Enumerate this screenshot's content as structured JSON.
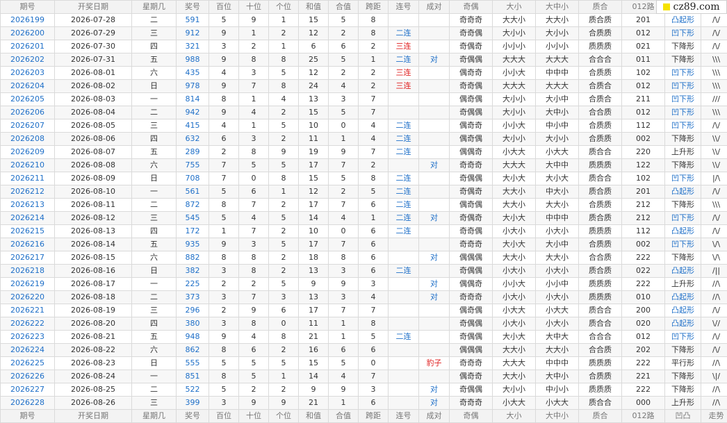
{
  "header": [
    "期号",
    "开奖日期",
    "星期几",
    "奖号",
    "百位",
    "十位",
    "个位",
    "和值",
    "合值",
    "跨距",
    "连号",
    "成对",
    "奇偶",
    "大小",
    "大中小",
    "质合",
    "012路",
    "凹凸",
    "走势"
  ],
  "logo": "cz89.com",
  "rows": [
    [
      "2026199",
      "2026-07-28",
      "二",
      "591",
      "5",
      "9",
      "1",
      "15",
      "5",
      "8",
      "",
      "",
      "奇奇奇",
      "大大小",
      "大大小",
      "质合质",
      "201",
      "凸起形",
      "/\\/"
    ],
    [
      "2026200",
      "2026-07-29",
      "三",
      "912",
      "9",
      "1",
      "2",
      "12",
      "2",
      "8",
      "二连",
      "",
      "奇奇偶",
      "大小小",
      "大小小",
      "合质质",
      "012",
      "凹下形",
      "/\\/"
    ],
    [
      "2026201",
      "2026-07-30",
      "四",
      "321",
      "3",
      "2",
      "1",
      "6",
      "6",
      "2",
      "三连",
      "",
      "奇偶奇",
      "小小小",
      "小小小",
      "质质质",
      "021",
      "下降形",
      "/\\/"
    ],
    [
      "2026202",
      "2026-07-31",
      "五",
      "988",
      "9",
      "8",
      "8",
      "25",
      "5",
      "1",
      "二连",
      "对",
      "奇偶偶",
      "大大大",
      "大大大",
      "合合合",
      "011",
      "下降形",
      "\\\\\\"
    ],
    [
      "2026203",
      "2026-08-01",
      "六",
      "435",
      "4",
      "3",
      "5",
      "12",
      "2",
      "2",
      "三连",
      "",
      "偶奇奇",
      "小小大",
      "中中中",
      "合质质",
      "102",
      "凹下形",
      "\\\\\\"
    ],
    [
      "2026204",
      "2026-08-02",
      "日",
      "978",
      "9",
      "7",
      "8",
      "24",
      "4",
      "2",
      "三连",
      "",
      "奇奇偶",
      "大大大",
      "大大大",
      "合质合",
      "012",
      "凹下形",
      "\\\\\\"
    ],
    [
      "2026205",
      "2026-08-03",
      "一",
      "814",
      "8",
      "1",
      "4",
      "13",
      "3",
      "7",
      "",
      "",
      "偶奇偶",
      "大小小",
      "大小中",
      "合质合",
      "211",
      "凹下形",
      "///"
    ],
    [
      "2026206",
      "2026-08-04",
      "二",
      "942",
      "9",
      "4",
      "2",
      "15",
      "5",
      "7",
      "",
      "",
      "奇偶偶",
      "大小小",
      "大中小",
      "合合质",
      "012",
      "凹下形",
      "\\\\\\"
    ],
    [
      "2026207",
      "2026-08-05",
      "三",
      "415",
      "4",
      "1",
      "5",
      "10",
      "0",
      "4",
      "二连",
      "",
      "偶奇奇",
      "小小大",
      "中小中",
      "合质质",
      "112",
      "凹下形",
      "/\\/"
    ],
    [
      "2026208",
      "2026-08-06",
      "四",
      "632",
      "6",
      "3",
      "2",
      "11",
      "1",
      "4",
      "二连",
      "",
      "偶奇偶",
      "大小小",
      "大小小",
      "合质质",
      "002",
      "下降形",
      "\\\\/"
    ],
    [
      "2026209",
      "2026-08-07",
      "五",
      "289",
      "2",
      "8",
      "9",
      "19",
      "9",
      "7",
      "二连",
      "",
      "偶偶奇",
      "小大大",
      "小大大",
      "质合合",
      "220",
      "上升形",
      "\\\\/"
    ],
    [
      "2026210",
      "2026-08-08",
      "六",
      "755",
      "7",
      "5",
      "5",
      "17",
      "7",
      "2",
      "",
      "对",
      "奇奇奇",
      "大大大",
      "大中中",
      "质质质",
      "122",
      "下降形",
      "\\\\/"
    ],
    [
      "2026211",
      "2026-08-09",
      "日",
      "708",
      "7",
      "0",
      "8",
      "15",
      "5",
      "8",
      "二连",
      "",
      "奇偶偶",
      "大小大",
      "大小大",
      "质合合",
      "102",
      "凹下形",
      "|/\\"
    ],
    [
      "2026212",
      "2026-08-10",
      "一",
      "561",
      "5",
      "6",
      "1",
      "12",
      "2",
      "5",
      "二连",
      "",
      "奇偶奇",
      "大大小",
      "中大小",
      "质合质",
      "201",
      "凸起形",
      "/\\/"
    ],
    [
      "2026213",
      "2026-08-11",
      "二",
      "872",
      "8",
      "7",
      "2",
      "17",
      "7",
      "6",
      "二连",
      "",
      "偶奇偶",
      "大大小",
      "大大小",
      "合质质",
      "212",
      "下降形",
      "\\\\\\"
    ],
    [
      "2026214",
      "2026-08-12",
      "三",
      "545",
      "5",
      "4",
      "5",
      "14",
      "4",
      "1",
      "二连",
      "对",
      "奇偶奇",
      "大小大",
      "中中中",
      "质合质",
      "212",
      "凹下形",
      "/\\/"
    ],
    [
      "2026215",
      "2026-08-13",
      "四",
      "172",
      "1",
      "7",
      "2",
      "10",
      "0",
      "6",
      "二连",
      "",
      "奇奇偶",
      "小大小",
      "小大小",
      "质质质",
      "112",
      "凸起形",
      "/\\/"
    ],
    [
      "2026216",
      "2026-08-14",
      "五",
      "935",
      "9",
      "3",
      "5",
      "17",
      "7",
      "6",
      "",
      "",
      "奇奇奇",
      "大小大",
      "大小中",
      "合质质",
      "002",
      "凹下形",
      "\\/\\"
    ],
    [
      "2026217",
      "2026-08-15",
      "六",
      "882",
      "8",
      "8",
      "2",
      "18",
      "8",
      "6",
      "",
      "对",
      "偶偶偶",
      "大大小",
      "大大小",
      "合合质",
      "222",
      "下降形",
      "\\/\\"
    ],
    [
      "2026218",
      "2026-08-16",
      "日",
      "382",
      "3",
      "8",
      "2",
      "13",
      "3",
      "6",
      "二连",
      "",
      "奇偶偶",
      "小大小",
      "小大小",
      "质合质",
      "022",
      "凸起形",
      "/||"
    ],
    [
      "2026219",
      "2026-08-17",
      "一",
      "225",
      "2",
      "2",
      "5",
      "9",
      "9",
      "3",
      "",
      "对",
      "偶偶奇",
      "小小大",
      "小小中",
      "质质质",
      "222",
      "上升形",
      "//\\"
    ],
    [
      "2026220",
      "2026-08-18",
      "二",
      "373",
      "3",
      "7",
      "3",
      "13",
      "3",
      "4",
      "",
      "对",
      "奇奇奇",
      "小大小",
      "小大小",
      "质质质",
      "010",
      "凸起形",
      "//\\"
    ],
    [
      "2026221",
      "2026-08-19",
      "三",
      "296",
      "2",
      "9",
      "6",
      "17",
      "7",
      "7",
      "",
      "",
      "偶奇偶",
      "小大大",
      "小大大",
      "质合合",
      "200",
      "凸起形",
      "/\\/"
    ],
    [
      "2026222",
      "2026-08-20",
      "四",
      "380",
      "3",
      "8",
      "0",
      "11",
      "1",
      "8",
      "",
      "",
      "奇偶偶",
      "小大小",
      "小大小",
      "质合合",
      "020",
      "凸起形",
      "\\//"
    ],
    [
      "2026223",
      "2026-08-21",
      "五",
      "948",
      "9",
      "4",
      "8",
      "21",
      "1",
      "5",
      "二连",
      "",
      "奇偶偶",
      "大小大",
      "大中大",
      "合合合",
      "012",
      "凹下形",
      "/\\/"
    ],
    [
      "2026224",
      "2026-08-22",
      "六",
      "862",
      "8",
      "6",
      "2",
      "16",
      "6",
      "6",
      "",
      "",
      "偶偶偶",
      "大大小",
      "大大小",
      "合合质",
      "202",
      "下降形",
      "/\\/"
    ],
    [
      "2026225",
      "2026-08-23",
      "日",
      "555",
      "5",
      "5",
      "5",
      "15",
      "5",
      "0",
      "",
      "豹子",
      "奇奇奇",
      "大大大",
      "中中中",
      "质质质",
      "222",
      "平行形",
      "//\\"
    ],
    [
      "2026226",
      "2026-08-24",
      "一",
      "851",
      "8",
      "5",
      "1",
      "14",
      "4",
      "7",
      "",
      "",
      "偶奇奇",
      "大大小",
      "大中小",
      "合质质",
      "221",
      "下降形",
      "\\|/"
    ],
    [
      "2026227",
      "2026-08-25",
      "二",
      "522",
      "5",
      "2",
      "2",
      "9",
      "9",
      "3",
      "",
      "对",
      "奇偶偶",
      "大小小",
      "中小小",
      "质质质",
      "222",
      "下降形",
      "//\\"
    ],
    [
      "2026228",
      "2026-08-26",
      "三",
      "399",
      "3",
      "9",
      "9",
      "21",
      "1",
      "6",
      "",
      "对",
      "奇奇奇",
      "小大大",
      "小大大",
      "质合合",
      "000",
      "上升形",
      "//\\"
    ]
  ]
}
